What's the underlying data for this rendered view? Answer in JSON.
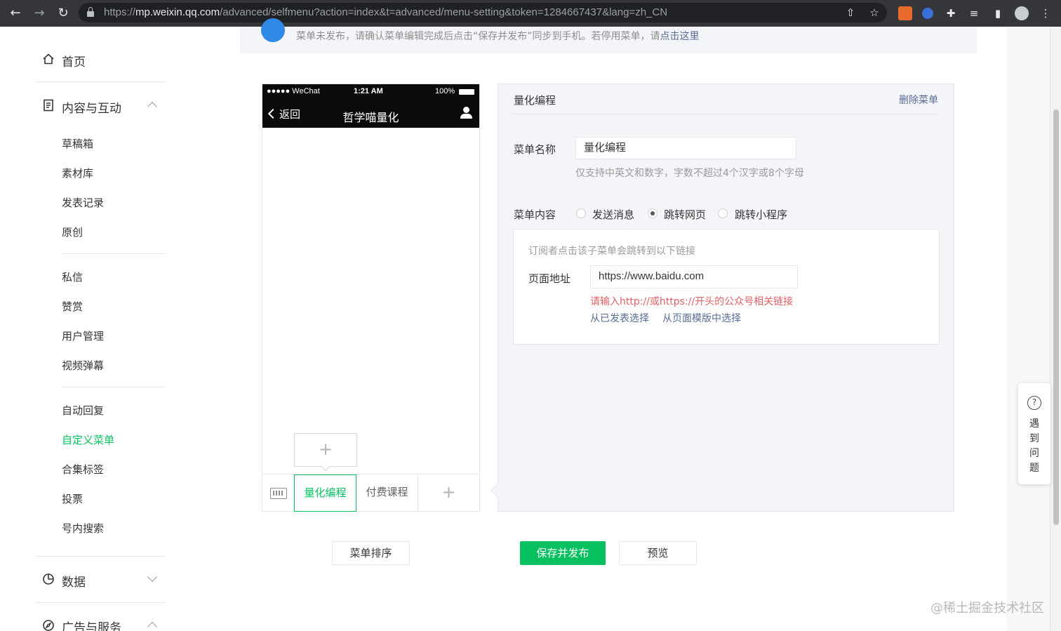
{
  "browser": {
    "url_scheme": "https://",
    "url_host": "mp.weixin.qq.com",
    "url_path": "/advanced/selfmenu?action=index&t=advanced/menu-setting&token=1284667437&lang=zh_CN",
    "icons": [
      "back-icon",
      "forward-icon",
      "reload-icon",
      "lock-icon",
      "share-icon",
      "star-icon",
      "extension-icon",
      "extension-icon",
      "puzzle-icon",
      "reading-list-icon",
      "sidebar-icon",
      "profile-avatar",
      "menu-icon"
    ]
  },
  "sidebar": {
    "home": "首页",
    "content_group": "内容与互动",
    "content_items": [
      "草稿箱",
      "素材库",
      "发表记录",
      "原创"
    ],
    "interact_items": [
      "私信",
      "赞赏",
      "用户管理",
      "视频弹幕"
    ],
    "menu_items": [
      "自动回复",
      "自定义菜单",
      "合集标签",
      "投票",
      "号内搜索"
    ],
    "data_group": "数据",
    "ads_group": "广告与服务",
    "active_color": "#07c160"
  },
  "notice": {
    "text": "菜单未发布，请确认菜单编辑完成后点击“保存并发布”同步到手机。若停用菜单，请",
    "link": "点击这里"
  },
  "phone": {
    "carrier": "●●●●● WeChat",
    "time": "1:21 AM",
    "battery": "100%",
    "back": "返回",
    "title": "哲学喵量化",
    "sub_add": "+",
    "tabs": [
      "量化编程",
      "付费课程"
    ],
    "add": "+"
  },
  "editor": {
    "title": "量化编程",
    "delete": "删除菜单",
    "name_label": "菜单名称",
    "name_value": "量化编程",
    "name_hint": "仅支持中英文和数字，字数不超过4个汉字或8个字母",
    "content_label": "菜单内容",
    "options": [
      "发送消息",
      "跳转网页",
      "跳转小程序"
    ],
    "selected_option": "跳转网页",
    "link_desc": "订阅者点击该子菜单会跳转到以下链接",
    "page_label": "页面地址",
    "page_value": "https://www.baidu.com",
    "page_error": "请输入http://或https://开头的公众号相关链接",
    "pick_published": "从已发表选择",
    "pick_template": "从页面模版中选择"
  },
  "actions": {
    "sort": "菜单排序",
    "save": "保存并发布",
    "preview": "预览"
  },
  "help": {
    "icon": "?",
    "text": "遇到问题"
  },
  "watermark": "@稀土掘金技术社区"
}
